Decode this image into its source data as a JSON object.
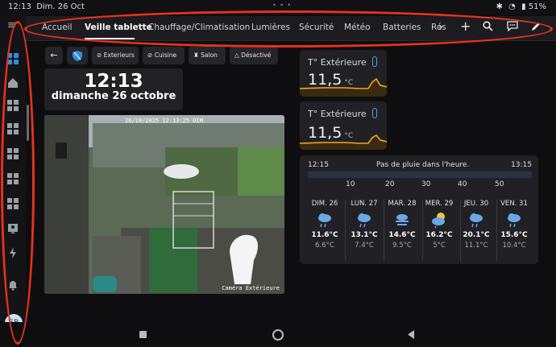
{
  "status": {
    "time": "12:13",
    "date": "Dim. 26 Oct",
    "battery": "51%"
  },
  "tabs": [
    "Accueil",
    "Veille tablette",
    "Chauffage/Climatisation",
    "Lumières",
    "Sécurité",
    "Météo",
    "Batteries",
    "Rés"
  ],
  "active_tab": "Veille tablette",
  "toolbar_icons": [
    "chevron-right-icon",
    "plus-icon",
    "search-icon",
    "chat-icon",
    "pencil-icon"
  ],
  "chips": [
    "Exterieurs",
    "Cuisine",
    "Salon",
    "Désactivé"
  ],
  "clock": {
    "time": "12:13",
    "date": "dimanche 26 octobre"
  },
  "camera": {
    "timestamp": "26/10/2025 12:13:25 DIM",
    "label": "Caméra Extérieure"
  },
  "temps": [
    {
      "label": "T° Extérieure",
      "value": "11,5",
      "unit": "°C"
    },
    {
      "label": "T° Extérieure",
      "value": "11,5",
      "unit": "°C"
    }
  ],
  "weather": {
    "start": "12:15",
    "message": "Pas de pluie dans l'heure.",
    "end": "13:15",
    "ticks": [
      "10",
      "20",
      "30",
      "40",
      "50"
    ],
    "days": [
      {
        "name": "DIM. 26",
        "hi": "11.6°C",
        "lo": "6.6°C",
        "icon": "rain-cloud-icon"
      },
      {
        "name": "LUN. 27",
        "hi": "13.1°C",
        "lo": "7.4°C",
        "icon": "rain-cloud-icon"
      },
      {
        "name": "MAR. 28",
        "hi": "14.6°C",
        "lo": "9.5°C",
        "icon": "fog-icon"
      },
      {
        "name": "MER. 29",
        "hi": "16.2°C",
        "lo": "5°C",
        "icon": "sun-cloud-icon"
      },
      {
        "name": "JEU. 30",
        "hi": "20.1°C",
        "lo": "11.1°C",
        "icon": "rain-cloud-icon"
      },
      {
        "name": "VEN. 31",
        "hi": "15.6°C",
        "lo": "10.4°C",
        "icon": "rain-cloud-icon"
      }
    ]
  },
  "user": {
    "initials": "SP"
  },
  "colors": {
    "accent": "#2f8fe0",
    "chart": "#f5a524",
    "annotation": "#e6321e"
  }
}
